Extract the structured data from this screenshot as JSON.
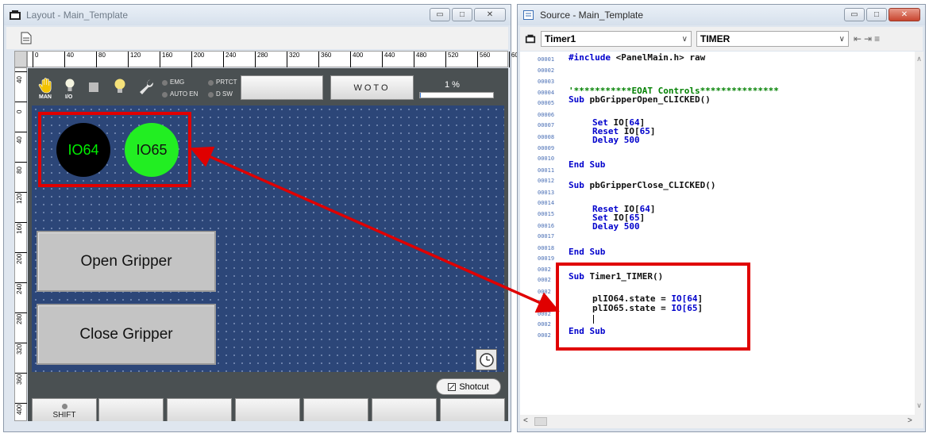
{
  "layout_window": {
    "title": "Layout - Main_Template",
    "ruler_h_ticks": [
      "0",
      "40",
      "80",
      "120",
      "160",
      "200",
      "240",
      "280",
      "320",
      "360",
      "400",
      "440",
      "480",
      "520",
      "560",
      "600"
    ],
    "ruler_v_ticks": [
      "40",
      "0",
      "40",
      "80",
      "120",
      "160",
      "200",
      "240",
      "280",
      "320",
      "360",
      "400"
    ],
    "header": {
      "man_label": "MAN",
      "io_label": "I/O",
      "emg_label": "EMG",
      "prtct_label": "PRTCT",
      "autoen_label": "AUTO EN",
      "dsw_label": "D SW",
      "woto_label": "WOTO",
      "percent_label": "1 %",
      "percent_value": 1
    },
    "leds": [
      {
        "label": "IO64",
        "fill": "#000000",
        "text_color": "#00ee00"
      },
      {
        "label": "IO65",
        "fill": "#22ee22",
        "text_color": "#111111"
      }
    ],
    "buttons": {
      "open": "Open Gripper",
      "close": "Close Gripper"
    },
    "shotcut_label": "Shotcut",
    "shift_label": "SHIFT"
  },
  "source_window": {
    "title": "Source - Main_Template",
    "object_combo": "Timer1",
    "event_combo": "TIMER",
    "line_numbers": [
      "00001",
      "00002",
      "00003",
      "00004",
      "00005",
      "00006",
      "00007",
      "00008",
      "00009",
      "00010",
      "00011",
      "00012",
      "00013",
      "00014",
      "00015",
      "00016",
      "00017",
      "00018",
      "00019",
      "0002",
      "0002",
      "0002",
      "0002",
      "0002",
      "0002",
      "0002"
    ],
    "code": {
      "l1a": "#include",
      "l1b": " <PanelMain.h> raw",
      "l4": "'***********EOAT Controls***************",
      "l5a": "Sub",
      "l5b": " pbGripperOpen_CLICKED()",
      "l7a": "Set",
      "l7b": " IO[",
      "l7c": "64",
      "l7d": "]",
      "l8a": "Reset",
      "l8b": " IO[",
      "l8c": "65",
      "l8d": "]",
      "l9a": "Delay",
      "l9b": "500",
      "l11a": "End",
      "l11b": "Sub",
      "l13a": "Sub",
      "l13b": " pbGripperClose_CLICKED()",
      "l15a": "Reset",
      "l15b": " IO[",
      "l15c": "64",
      "l15d": "]",
      "l16a": "Set",
      "l16b": " IO[",
      "l16c": "65",
      "l16d": "]",
      "l17a": "Delay",
      "l17b": "500",
      "l19a": "End",
      "l19b": "Sub",
      "l21a": "Sub",
      "l21b": " Timer1_TIMER()",
      "l23a": "plIO64.state = ",
      "l23b": "IO[",
      "l23c": "64",
      "l23d": "]",
      "l24a": "plIO65.state = ",
      "l24b": "IO[",
      "l24c": "65",
      "l24d": "]",
      "l26a": "End",
      "l26b": "Sub"
    }
  },
  "colors": {
    "annotation_red": "#e00000",
    "canvas_blue": "#2c4678"
  }
}
